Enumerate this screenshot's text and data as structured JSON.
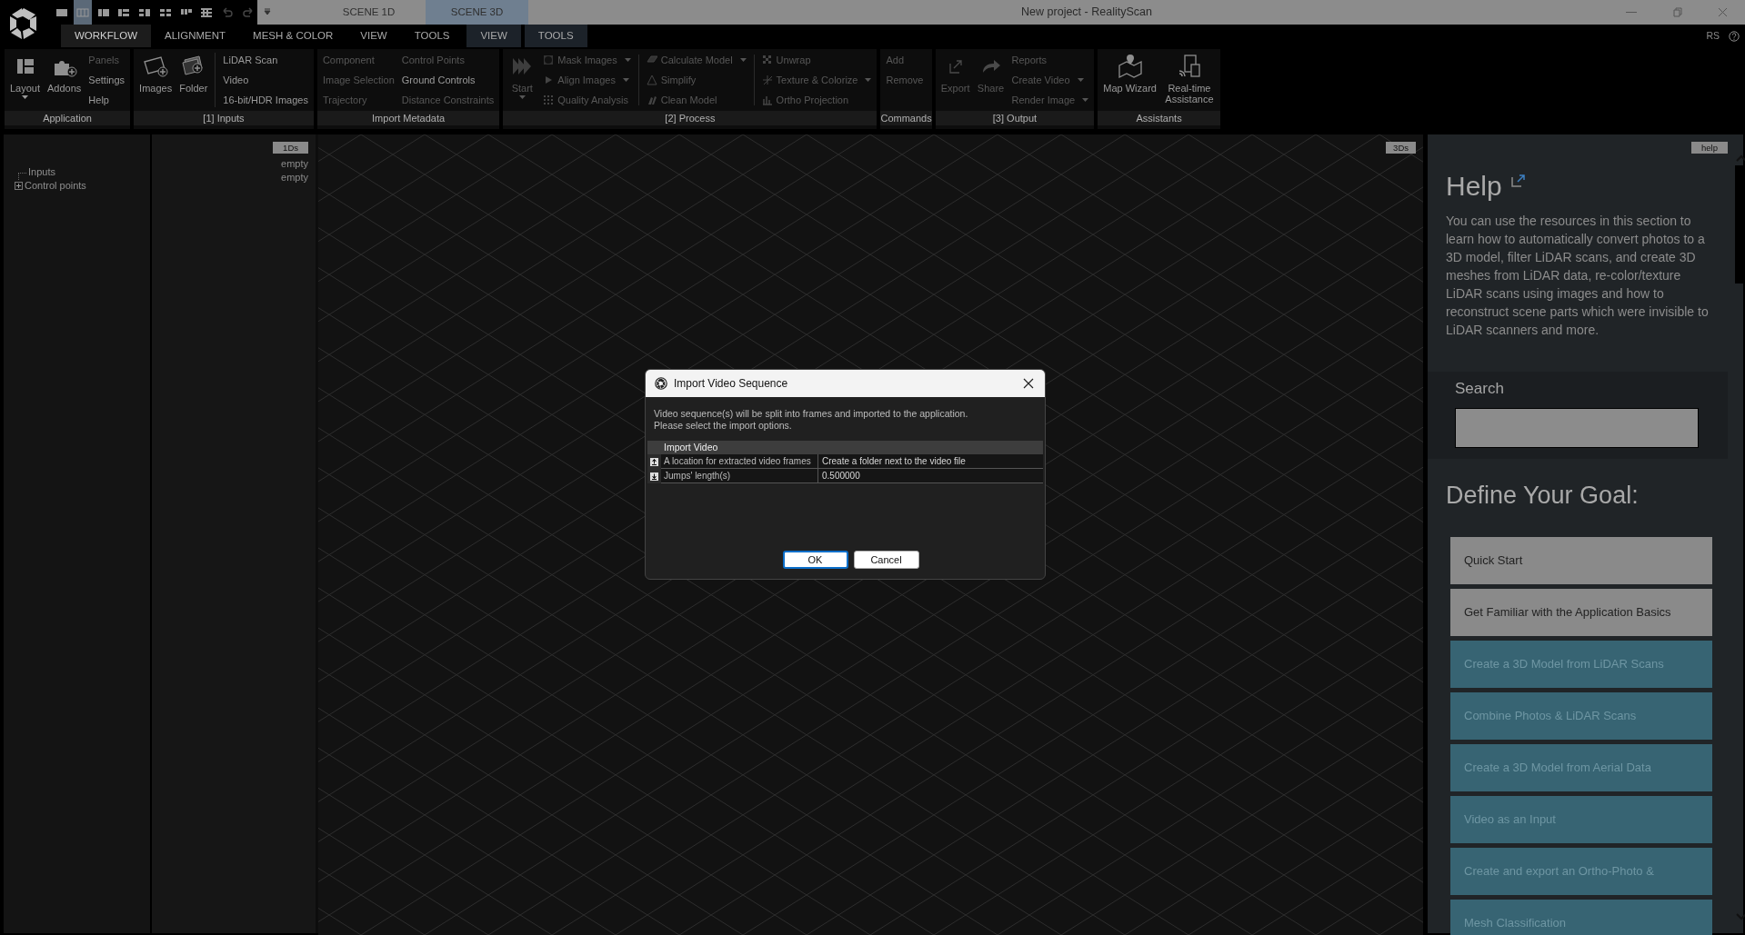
{
  "quick_toolbar": [
    {
      "kind": "layout",
      "selected": false,
      "disabled": false
    },
    {
      "kind": "layout",
      "selected": true,
      "disabled": false
    },
    {
      "kind": "layout",
      "selected": false,
      "disabled": false
    },
    {
      "kind": "layout",
      "selected": false,
      "disabled": false
    },
    {
      "kind": "layout",
      "selected": false,
      "disabled": false
    },
    {
      "kind": "layout",
      "selected": false,
      "disabled": false
    },
    {
      "kind": "layout",
      "selected": false,
      "disabled": false
    },
    {
      "kind": "layout",
      "selected": false,
      "disabled": false
    },
    {
      "kind": "undo",
      "selected": false,
      "disabled": true
    },
    {
      "kind": "redo",
      "selected": false,
      "disabled": true
    }
  ],
  "scene_tabs": [
    {
      "label": "SCENE 1D",
      "selected": false
    },
    {
      "label": "SCENE 3D",
      "selected": true
    }
  ],
  "window": {
    "title": "New project - RealityScan"
  },
  "ribbon_tabs": [
    {
      "label": "WORKFLOW",
      "selected": true,
      "kind": "main"
    },
    {
      "label": "ALIGNMENT",
      "selected": false,
      "kind": "main"
    },
    {
      "label": "MESH & COLOR",
      "selected": false,
      "kind": "main"
    },
    {
      "label": "VIEW",
      "selected": false,
      "kind": "main"
    },
    {
      "label": "TOOLS",
      "selected": false,
      "kind": "main"
    },
    {
      "label": "VIEW",
      "selected": false,
      "kind": "scene"
    },
    {
      "label": "TOOLS",
      "selected": false,
      "kind": "scene"
    }
  ],
  "account": "RS",
  "ribbon_groups": [
    {
      "label": "Application",
      "columns": [
        {
          "kind": "large",
          "label": "Layout",
          "disabled": false,
          "dropdown": true
        },
        {
          "kind": "large",
          "label": "Addons",
          "disabled": false,
          "dropdown": false
        },
        {
          "kind": "stack",
          "items": [
            {
              "label": "Panels",
              "disabled": true,
              "dropdown": false
            },
            {
              "label": "Settings",
              "disabled": false,
              "dropdown": false
            },
            {
              "label": "Help",
              "disabled": false,
              "dropdown": false
            }
          ]
        }
      ]
    },
    {
      "label": "[1] Inputs",
      "columns": [
        {
          "kind": "large",
          "label": "Images",
          "disabled": false,
          "dropdown": false
        },
        {
          "kind": "large",
          "label": "Folder",
          "disabled": false,
          "dropdown": false
        },
        {
          "kind": "stack",
          "items": [
            {
              "label": "LiDAR Scan",
              "disabled": false,
              "dropdown": false
            },
            {
              "label": "Video",
              "disabled": false,
              "dropdown": false
            },
            {
              "label": "16-bit/HDR Images",
              "disabled": false,
              "dropdown": false
            }
          ]
        }
      ]
    },
    {
      "label": "Import Metadata",
      "columns": [
        {
          "kind": "stack",
          "items": [
            {
              "label": "Component",
              "disabled": true,
              "dropdown": false
            },
            {
              "label": "Image Selection",
              "disabled": true,
              "dropdown": false
            },
            {
              "label": "Trajectory",
              "disabled": true,
              "dropdown": false
            }
          ]
        },
        {
          "kind": "stack",
          "items": [
            {
              "label": "Control Points",
              "disabled": true,
              "dropdown": false
            },
            {
              "label": "Ground Controls",
              "disabled": false,
              "dropdown": false
            },
            {
              "label": "Distance Constraints",
              "disabled": true,
              "dropdown": false
            }
          ]
        }
      ]
    },
    {
      "label": "[2] Process",
      "columns": [
        {
          "kind": "large",
          "label": "Start",
          "disabled": true,
          "dropdown": true
        },
        {
          "kind": "stack",
          "items": [
            {
              "label": "Mask Images",
              "disabled": true,
              "dropdown": true
            },
            {
              "label": "Align Images",
              "disabled": true,
              "dropdown": true
            },
            {
              "label": "Quality Analysis",
              "disabled": true,
              "dropdown": false
            }
          ]
        },
        {
          "kind": "stack",
          "items": [
            {
              "label": "Calculate Model",
              "disabled": true,
              "dropdown": true
            },
            {
              "label": "Simplify",
              "disabled": true,
              "dropdown": false
            },
            {
              "label": "Clean Model",
              "disabled": true,
              "dropdown": false
            }
          ]
        },
        {
          "kind": "stack",
          "items": [
            {
              "label": "Unwrap",
              "disabled": true,
              "dropdown": false
            },
            {
              "label": "Texture & Colorize",
              "disabled": true,
              "dropdown": true
            },
            {
              "label": "Ortho Projection",
              "disabled": true,
              "dropdown": false
            }
          ]
        }
      ]
    },
    {
      "label": "Commands",
      "columns": [
        {
          "kind": "stack",
          "items": [
            {
              "label": "Add",
              "disabled": true,
              "dropdown": false
            },
            {
              "label": "Remove",
              "disabled": true,
              "dropdown": false
            }
          ]
        }
      ]
    },
    {
      "label": "[3] Output",
      "columns": [
        {
          "kind": "large",
          "label": "Export",
          "disabled": true,
          "dropdown": false
        },
        {
          "kind": "large",
          "label": "Share",
          "disabled": true,
          "dropdown": false
        },
        {
          "kind": "stack",
          "items": [
            {
              "label": "Reports",
              "disabled": true,
              "dropdown": false
            },
            {
              "label": "Create Video",
              "disabled": true,
              "dropdown": true
            },
            {
              "label": "Render Image",
              "disabled": true,
              "dropdown": true
            }
          ]
        }
      ]
    },
    {
      "label": "Assistants",
      "columns": [
        {
          "kind": "large",
          "label": "Map Wizard",
          "disabled": false,
          "dropdown": false
        },
        {
          "kind": "large",
          "label": "Real-time Assistance",
          "disabled": false,
          "dropdown": false
        }
      ]
    }
  ],
  "tree": [
    {
      "label": "Inputs",
      "kind": "leaf"
    },
    {
      "label": "Control points",
      "kind": "group",
      "expanded": false
    }
  ],
  "info_panel": {
    "badge": "1Ds",
    "values": [
      "empty",
      "empty"
    ]
  },
  "viewport": {
    "badge": "3Ds"
  },
  "help_panel": {
    "badge": "help",
    "heading": "Help",
    "text": "You can use the resources in this section to learn how to automatically convert photos to a 3D model, filter LiDAR scans, and create 3D meshes from LiDAR data, re-color/texture LiDAR scans using images and how to reconstruct scene parts which were invisible to LiDAR scanners and more.",
    "search_label": "Search",
    "goal_heading": "Define Your Goal:",
    "goals": [
      {
        "label": "Quick Start",
        "kind": "basic"
      },
      {
        "label": "Get Familiar with the Application Basics",
        "kind": "basic"
      },
      {
        "label": "Create a 3D Model from LiDAR Scans",
        "kind": "topic"
      },
      {
        "label": "Combine Photos & LiDAR Scans",
        "kind": "topic"
      },
      {
        "label": "Create a 3D Model from Aerial Data",
        "kind": "topic"
      },
      {
        "label": "Video as an Input",
        "kind": "topic"
      },
      {
        "label": "Create and export an Ortho-Photo &",
        "kind": "topic"
      },
      {
        "label": "Mesh Classification",
        "kind": "topic"
      }
    ]
  },
  "dialog": {
    "title": "Import Video Sequence",
    "message": [
      "Video sequence(s) will be split into frames and imported to the application.",
      "Please select the import options."
    ],
    "section": "Import Video",
    "rows": [
      {
        "name": "A location for extracted video frames",
        "value": "Create a folder next to the video file",
        "kind": "up"
      },
      {
        "name": "Jumps' length(s)",
        "value": "0.500000",
        "kind": "down"
      }
    ],
    "buttons": [
      {
        "label": "OK",
        "default": true
      },
      {
        "label": "Cancel",
        "default": false
      }
    ]
  }
}
